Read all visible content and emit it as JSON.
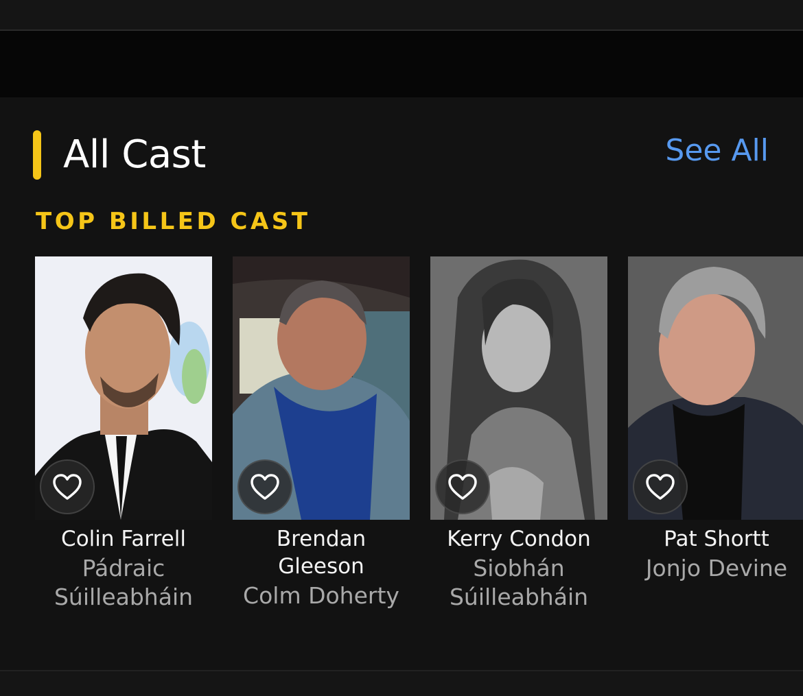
{
  "colors": {
    "accent_yellow": "#F5C518",
    "link_blue": "#5799EF",
    "background": "#121212"
  },
  "section": {
    "title": "All Cast",
    "see_all_label": "See All",
    "subheading": "TOP BILLED CAST"
  },
  "cast": [
    {
      "name": "Colin Farrell",
      "role": "Pádraic\nSúilleabháin",
      "icon": "heart-icon"
    },
    {
      "name": "Brendan\nGleeson",
      "role": "Colm Doherty",
      "icon": "heart-icon"
    },
    {
      "name": "Kerry Condon",
      "role": "Siobhán\nSúilleabháin",
      "icon": "heart-icon"
    },
    {
      "name": "Pat Shortt",
      "role": "Jonjo Devine",
      "icon": "heart-icon"
    }
  ]
}
